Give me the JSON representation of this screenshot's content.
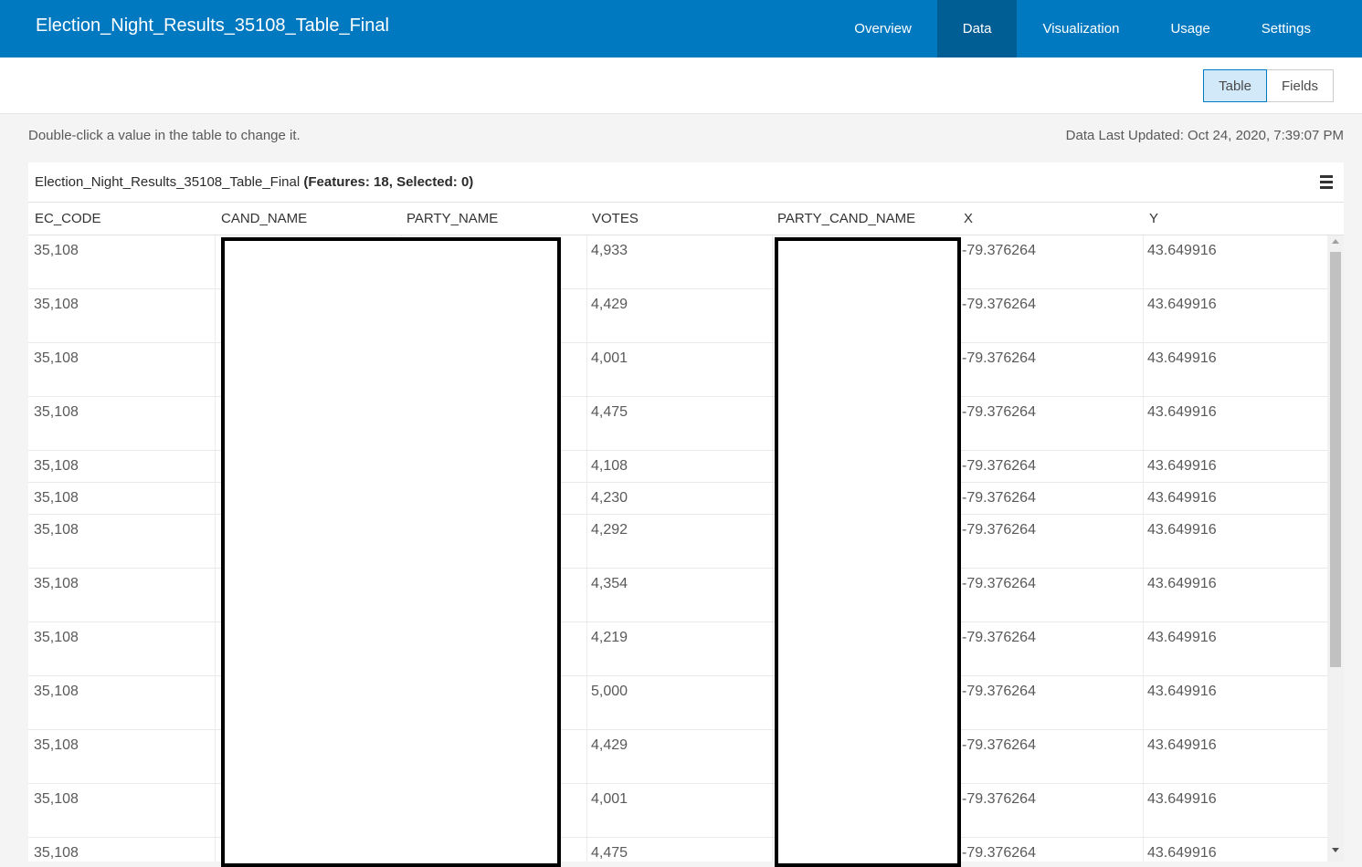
{
  "header": {
    "title": "Election_Night_Results_35108_Table_Final",
    "tabs": [
      {
        "label": "Overview",
        "active": false
      },
      {
        "label": "Data",
        "active": true
      },
      {
        "label": "Visualization",
        "active": false
      },
      {
        "label": "Usage",
        "active": false
      },
      {
        "label": "Settings",
        "active": false
      }
    ],
    "colors": {
      "bar": "#0079c1",
      "active_tab": "#005e95"
    }
  },
  "view_toggle": {
    "table_label": "Table",
    "fields_label": "Fields",
    "selected": "Table"
  },
  "info": {
    "hint": "Double-click a value in the table to change it.",
    "last_updated": "Data Last Updated: Oct 24, 2020, 7:39:07 PM"
  },
  "table": {
    "name": "Election_Night_Results_35108_Table_Final",
    "counts": "(Features: 18, Selected: 0)",
    "menu_icon": "hamburger-menu-icon",
    "columns": [
      "EC_CODE",
      "CAND_NAME",
      "PARTY_NAME",
      "VOTES",
      "PARTY_CAND_NAME",
      "X",
      "Y"
    ],
    "rows": [
      {
        "ec_code": "35,108",
        "votes": "4,933",
        "x": "-79.376264",
        "y": "43.649916"
      },
      {
        "ec_code": "35,108",
        "votes": "4,429",
        "x": "-79.376264",
        "y": "43.649916"
      },
      {
        "ec_code": "35,108",
        "votes": "4,001",
        "x": "-79.376264",
        "y": "43.649916"
      },
      {
        "ec_code": "35,108",
        "votes": "4,475",
        "x": "-79.376264",
        "y": "43.649916"
      },
      {
        "ec_code": "35,108",
        "votes": "4,108",
        "x": "-79.376264",
        "y": "43.649916"
      },
      {
        "ec_code": "35,108",
        "votes": "4,230",
        "x": "-79.376264",
        "y": "43.649916"
      },
      {
        "ec_code": "35,108",
        "votes": "4,292",
        "x": "-79.376264",
        "y": "43.649916"
      },
      {
        "ec_code": "35,108",
        "votes": "4,354",
        "x": "-79.376264",
        "y": "43.649916"
      },
      {
        "ec_code": "35,108",
        "votes": "4,219",
        "x": "-79.376264",
        "y": "43.649916"
      },
      {
        "ec_code": "35,108",
        "votes": "5,000",
        "x": "-79.376264",
        "y": "43.649916"
      },
      {
        "ec_code": "35,108",
        "votes": "4,429",
        "x": "-79.376264",
        "y": "43.649916"
      },
      {
        "ec_code": "35,108",
        "votes": "4,001",
        "x": "-79.376264",
        "y": "43.649916"
      },
      {
        "ec_code": "35,108",
        "votes": "4,475",
        "x": "-79.376264",
        "y": "43.649916"
      }
    ]
  }
}
